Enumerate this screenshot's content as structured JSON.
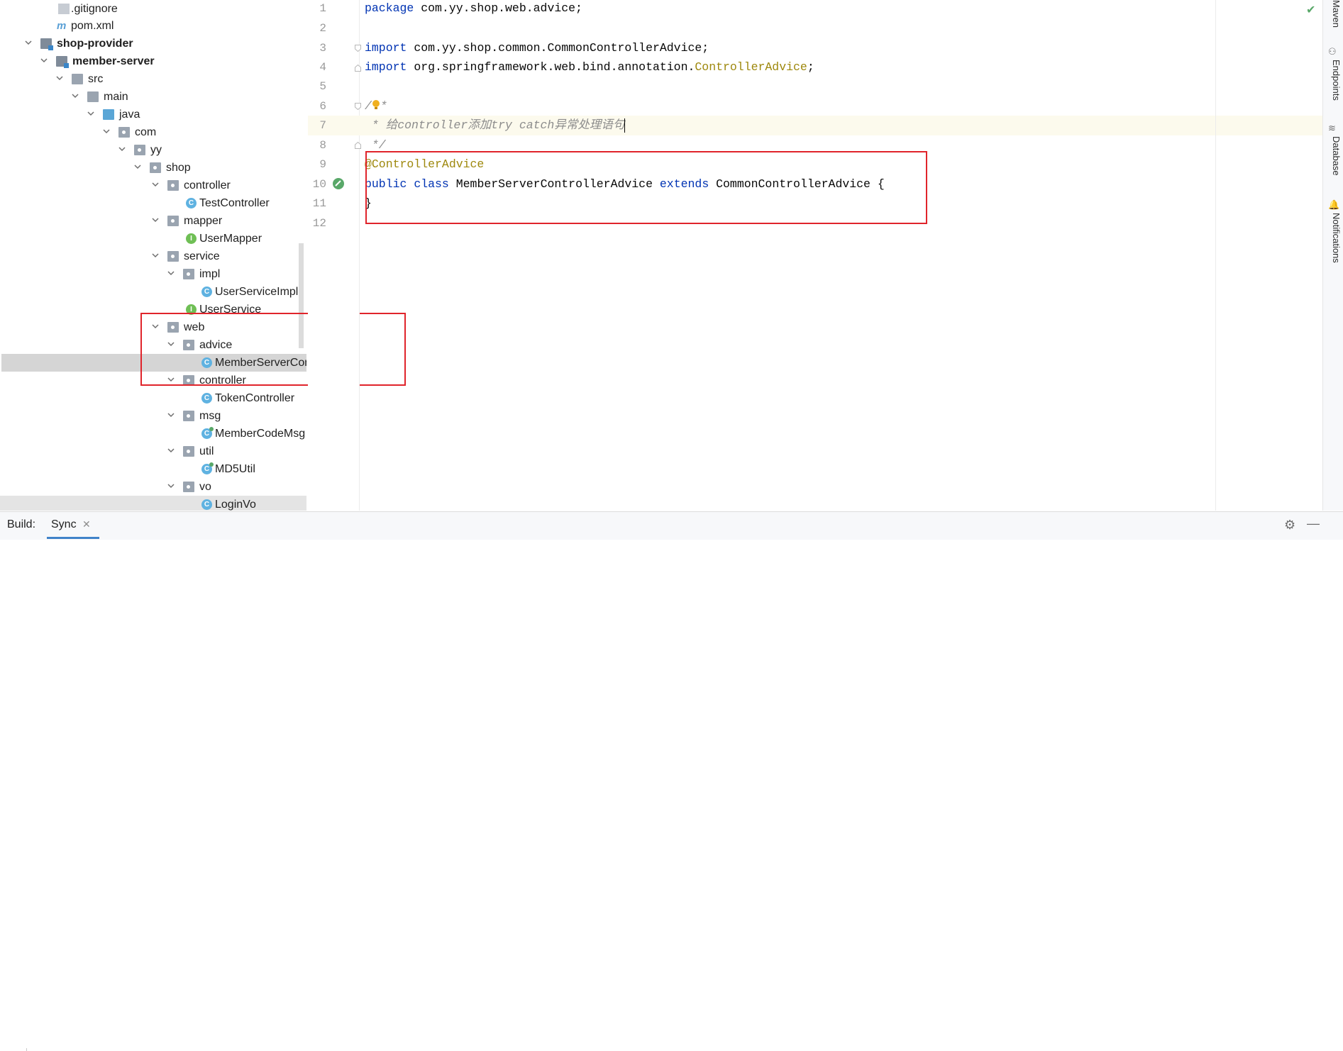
{
  "tree": {
    "items": [
      {
        "label": ".gitignore",
        "icon": "file-icon",
        "bold": false
      },
      {
        "label": "pom.xml",
        "icon": "maven-file-icon",
        "bold": false
      },
      {
        "label": "shop-provider",
        "icon": "module-folder-icon",
        "bold": true
      },
      {
        "label": "member-server",
        "icon": "module-folder-icon",
        "bold": true
      },
      {
        "label": "src",
        "icon": "folder-icon",
        "bold": false
      },
      {
        "label": "main",
        "icon": "folder-icon",
        "bold": false
      },
      {
        "label": "java",
        "icon": "source-folder-icon",
        "bold": false
      },
      {
        "label": "com",
        "icon": "package-icon",
        "bold": false
      },
      {
        "label": "yy",
        "icon": "package-icon",
        "bold": false
      },
      {
        "label": "shop",
        "icon": "package-icon",
        "bold": false
      },
      {
        "label": "controller",
        "icon": "package-icon",
        "bold": false
      },
      {
        "label": "TestController",
        "icon": "class-icon",
        "bold": false
      },
      {
        "label": "mapper",
        "icon": "package-icon",
        "bold": false
      },
      {
        "label": "UserMapper",
        "icon": "interface-icon",
        "bold": false
      },
      {
        "label": "service",
        "icon": "package-icon",
        "bold": false
      },
      {
        "label": "impl",
        "icon": "package-icon",
        "bold": false
      },
      {
        "label": "UserServiceImpl",
        "icon": "class-icon",
        "bold": false
      },
      {
        "label": "UserService",
        "icon": "interface-icon",
        "bold": false
      },
      {
        "label": "web",
        "icon": "package-icon",
        "bold": false
      },
      {
        "label": "advice",
        "icon": "package-icon",
        "bold": false
      },
      {
        "label": "MemberServerControllerAdvice",
        "icon": "class-icon",
        "bold": false,
        "selected": true
      },
      {
        "label": "controller",
        "icon": "package-icon",
        "bold": false
      },
      {
        "label": "TokenController",
        "icon": "class-icon",
        "bold": false
      },
      {
        "label": "msg",
        "icon": "package-icon",
        "bold": false
      },
      {
        "label": "MemberCodeMsg",
        "icon": "class-icon",
        "bold": false
      },
      {
        "label": "util",
        "icon": "package-icon",
        "bold": false
      },
      {
        "label": "MD5Util",
        "icon": "class-icon",
        "bold": false
      },
      {
        "label": "vo",
        "icon": "package-icon",
        "bold": false
      },
      {
        "label": "LoginVo",
        "icon": "class-icon",
        "bold": false
      }
    ]
  },
  "editor": {
    "line_numbers": [
      "1",
      "2",
      "3",
      "4",
      "5",
      "6",
      "7",
      "8",
      "9",
      "10",
      "11",
      "12"
    ],
    "lines": {
      "l1_kw": "package",
      "l1_rest": " com.yy.shop.web.advice;",
      "l3_kw": "import",
      "l3_rest": " com.yy.shop.common.CommonControllerAdvice;",
      "l4_kw": "import",
      "l4_rest": " org.springframework.web.bind.annotation.",
      "l4_ann": "ControllerAdvice",
      "l4_end": ";",
      "l6_a": "/",
      "l6_b": "*",
      "l7": " * 给controller添加try catch异常处理语句",
      "l8": " */",
      "l9": "@ControllerAdvice",
      "l10_kw1": "public",
      "l10_kw2": "class",
      "l10_name": " MemberServerControllerAdvice ",
      "l10_kw3": "extends",
      "l10_rest": " CommonControllerAdvice {",
      "l11": "}"
    }
  },
  "right_tools": {
    "maven": "Maven",
    "endpoints": "Endpoints",
    "database": "Database",
    "notifications": "Notifications"
  },
  "build_bar": {
    "build_label": "Build:",
    "sync_tab": "Sync",
    "close_glyph": "✕",
    "gear_glyph": "⚙",
    "minimize_glyph": "—"
  },
  "colors": {
    "keyword": "#0033b3",
    "annotation": "#9e880d",
    "comment": "#8c8c8c",
    "highlight_box": "#e0242b",
    "selection": "#d5d5d5"
  }
}
